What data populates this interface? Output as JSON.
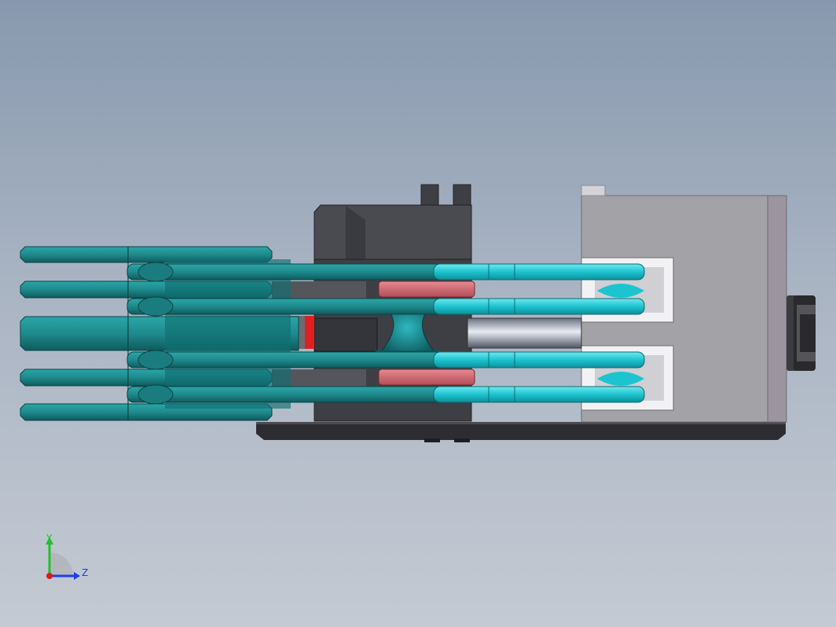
{
  "viewport": {
    "background_top": "#8798ae",
    "background_bottom": "#c4cad3"
  },
  "model": {
    "colors": {
      "teal_rod": "#1f8a8c",
      "teal_dark": "#0e5b5e",
      "cyan_highlight": "#1cc4d0",
      "housing_dark": "#3e3f44",
      "block_grey": "#a3a2a6",
      "base_plate": "#2c2c31",
      "red_accent": "#e02020",
      "pink_ring": "#d76f78",
      "steel_shaft": "#c9ced8"
    }
  },
  "triad": {
    "y_label": "Y",
    "z_label": "Z",
    "y_color": "#22c02a",
    "z_color": "#1e3cf0",
    "x_color": "#e01818"
  }
}
